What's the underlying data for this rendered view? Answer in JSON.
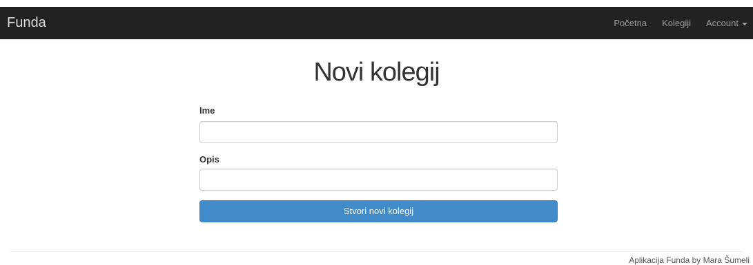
{
  "navbar": {
    "brand": "Funda",
    "links": [
      {
        "label": "Početna"
      },
      {
        "label": "Kolegiji"
      },
      {
        "label": "Account"
      }
    ]
  },
  "page": {
    "title": "Novi kolegij"
  },
  "form": {
    "name_label": "Ime",
    "name_value": "",
    "description_label": "Opis",
    "description_value": "",
    "submit_label": "Stvori novi kolegij"
  },
  "footer": {
    "text": "Aplikacija Funda by Mara Šumeli"
  },
  "colors": {
    "navbar_bg": "#222222",
    "primary_button": "#428bca"
  }
}
